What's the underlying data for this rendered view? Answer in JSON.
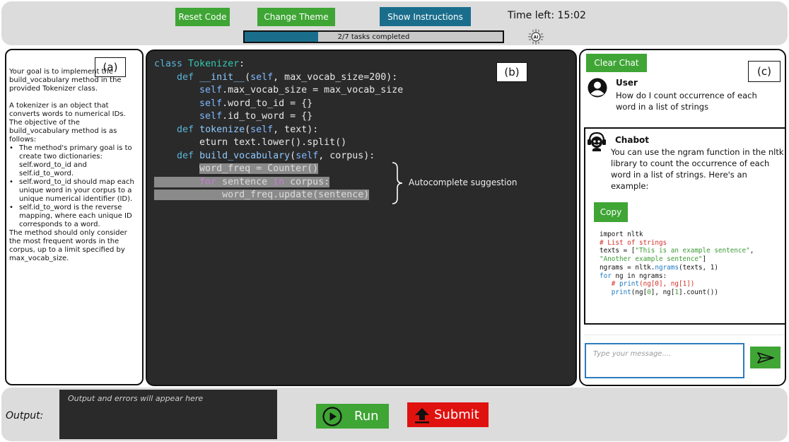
{
  "toolbar": {
    "reset_label": "Reset Code",
    "theme_label": "Change Theme",
    "instructions_label": "Show Instructions",
    "time_left": "Time left: 15:02",
    "progress_text": "2/7 tasks completed",
    "progress_fraction": 0.2857,
    "ai_icon": "ai-icon"
  },
  "instructions": {
    "tag": "(a)",
    "intro": "Your goal is to implement the build_vocabulary method in the provided Tokenizer class.",
    "p2": "A tokenizer is an object that converts words to numerical IDs. The objective of the build_vocabulary method is as follows:",
    "bullets": [
      "The method's primary goal is to create two dictionaries: self.word_to_id and self.id_to_word.",
      "self.word_to_id should map each unique word in your corpus to a unique numerical identifier (ID).",
      " self.id_to_word is the reverse mapping, where each unique ID corresponds to a word."
    ],
    "outro": "The method should only consider the most frequent words in the corpus, up to a limit specified by max_vocab_size."
  },
  "editor": {
    "tag": "(b)",
    "autocomplete_label": "Autocomplete suggestion",
    "lines": {
      "l1_kw": "class",
      "l1_name": "Tokenizer",
      "l1_end": ":",
      "l2_kw": "def",
      "l2_name": "__init__",
      "l2_a": "(",
      "l2_self": "self",
      "l2_b": ", max_vocab_size=",
      "l2_num": "200",
      "l2_c": "):",
      "l3_self": "self",
      "l3_rest": ".max_vocab_size = max_vocab_size",
      "l4_self": "self",
      "l4_rest": ".word_to_id = {}",
      "l5_self": "self",
      "l5_rest": ".id_to_word = {}",
      "l6_kw": "def",
      "l6_name": "tokenize",
      "l6_a": "(",
      "l6_self": "self",
      "l6_b": ", text):",
      "l7": "eturn text.lower().split()",
      "l8_kw": "def",
      "l8_name": "build_vocabulary",
      "l8_a": "(",
      "l8_self": "self",
      "l8_b": ", corpus):",
      "l9": "word_freq = Counter()",
      "l10_for": "for",
      "l10_a": " sentence ",
      "l10_in": "in",
      "l10_b": " corpus:",
      "l11": "word_freq.update(sentence)"
    }
  },
  "chat": {
    "tag": "(c)",
    "clear_label": "Clear Chat",
    "user_name": "User",
    "user_message": "How do I count occurrence of each word in a list of strings",
    "bot_name": "Chabot",
    "bot_message": "You can use the ngram function in the nltk library to count the occurrence of each word in a list of strings. Here's an example:",
    "copy_label": "Copy",
    "snippet": {
      "s1": "import nltk",
      "s2": "# List of strings",
      "s3_a": "texts = [",
      "s3_str": "\"This is an example sentence\"",
      "s3_b": ",",
      "s4_str": "\"Another example sentence\"",
      "s4_b": "]",
      "s5_a": "ngrams = nltk.",
      "s5_fn": "ngrams",
      "s5_b": "(texts, 1)",
      "s6_for": "for",
      "s6_rest": " ng in ngrams:",
      "s7_a": "   # ",
      "s7_fn": "print",
      "s7_b": "(ng[",
      "s7_n0": "0",
      "s7_c": "], ng[",
      "s7_n1": "1",
      "s7_d": "])",
      "s8_fn": "print",
      "s8_a": "(ng[",
      "s8_n0": "0",
      "s8_b": "], ng[",
      "s8_n1": "1",
      "s8_c": "].count())"
    },
    "input_placeholder": "Type your message....",
    "send_icon": "send-icon"
  },
  "output": {
    "label": "Output:",
    "placeholder": "Output and errors will appear here",
    "run_label": "Run",
    "submit_label": "Submit"
  }
}
